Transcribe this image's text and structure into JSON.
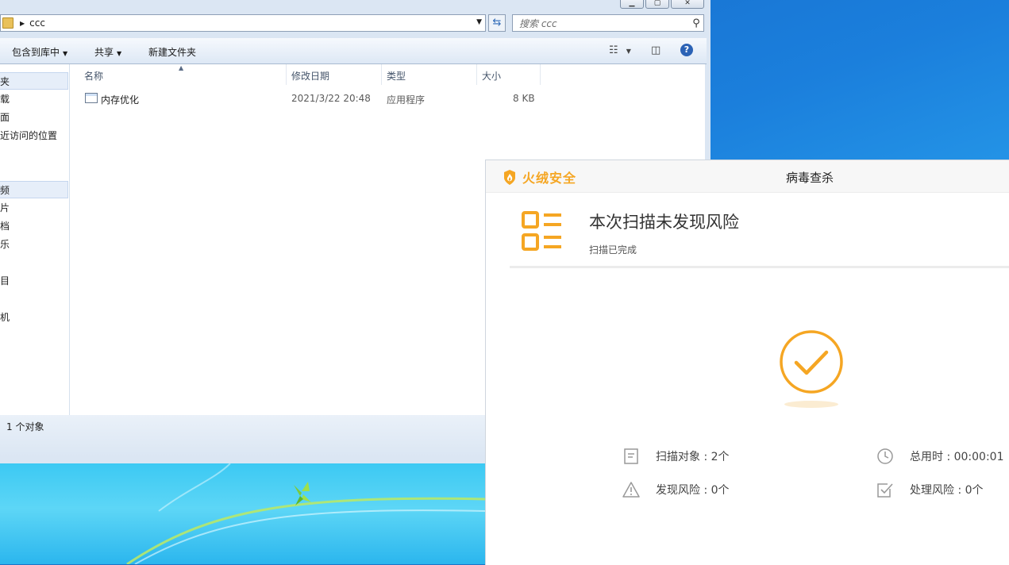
{
  "explorer": {
    "address": {
      "path": "ccc"
    },
    "search": {
      "placeholder": "搜索 ccc"
    },
    "toolbar": {
      "include_library": "包含到库中",
      "share": "共享",
      "new_folder": "新建文件夹"
    },
    "nav": {
      "items": [
        "夹",
        "载",
        "面",
        "近访问的位置",
        "频",
        "片",
        "档",
        "乐",
        "目",
        "机"
      ]
    },
    "columns": {
      "name": "名称",
      "modified": "修改日期",
      "type": "类型",
      "size": "大小"
    },
    "files": [
      {
        "name": "内存优化",
        "modified": "2021/3/22 20:48",
        "type": "应用程序",
        "size": "8 KB"
      }
    ],
    "status": "1 个对象"
  },
  "antivirus": {
    "brand": "火绒安全",
    "title": "病毒查杀",
    "headline": "本次扫描未发现风险",
    "subline": "扫描已完成",
    "accent": "#f5a623",
    "stats": {
      "scan_targets": "扫描对象 : 2个",
      "time_used": "总用时 : 00:00:01",
      "risks_found": "发现风险 : 0个",
      "risks_handled": "处理风险 : 0个"
    }
  }
}
